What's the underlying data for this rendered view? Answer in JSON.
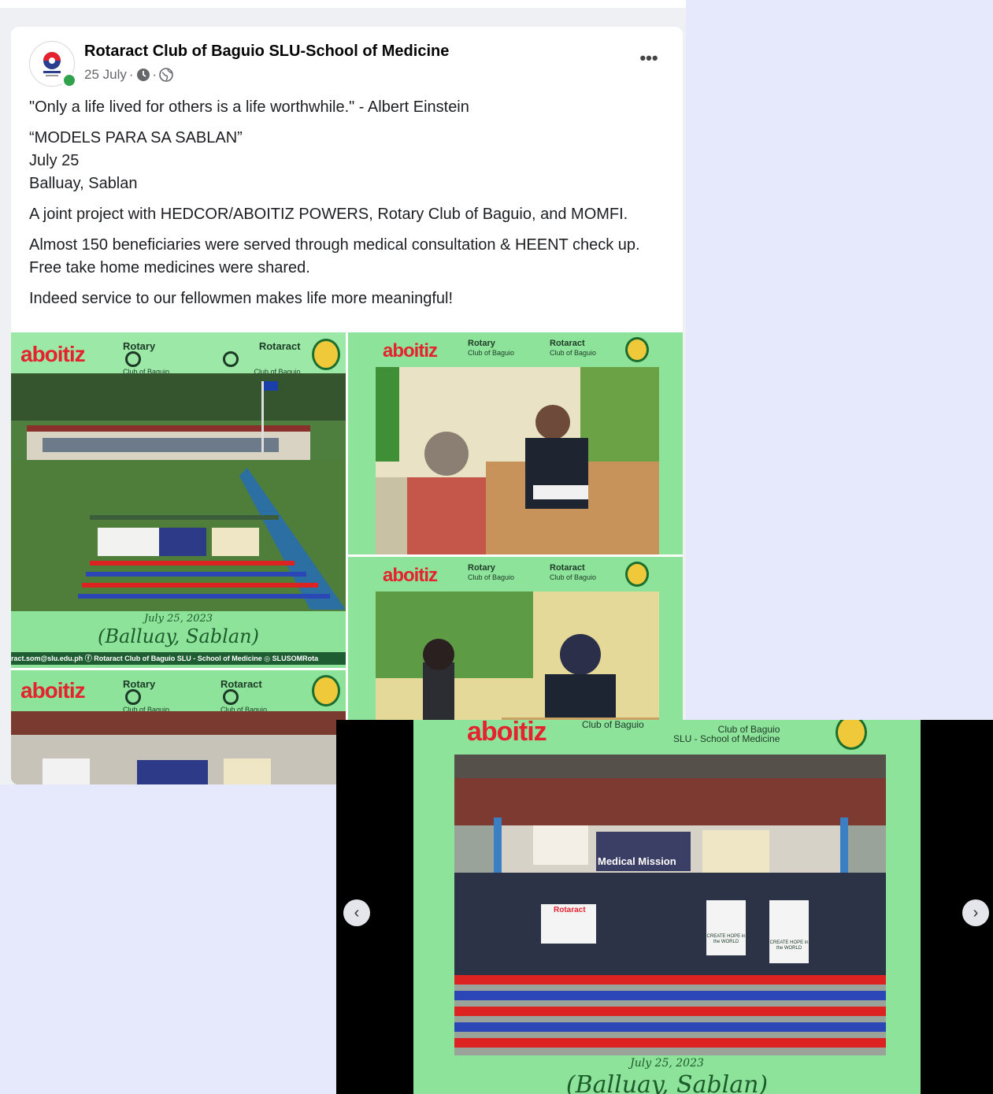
{
  "post": {
    "page_name": "Rotaract Club of Baguio SLU-School of Medicine",
    "date": "25 July",
    "meta_sep": "·",
    "paragraphs": {
      "quote": "\"Only a life lived for others is a life worthwhile.\" - Albert Einstein",
      "title": "“MODELS PARA SA SABLAN”",
      "date_line": "July 25",
      "place_line": "Balluay, Sablan",
      "joint": "A joint project with HEDCOR/ABOITIZ POWERS, Rotary Club of Baguio, and MOMFI.",
      "served": "Almost 150 beneficiaries were served through medical consultation & HEENT check up. Free take home medicines were shared.",
      "closing": "Indeed service to our fellowmen makes life more meaningful!"
    },
    "more_label": "•••"
  },
  "tiles": {
    "brand": "aboitiz",
    "rotary": "Rotary",
    "rotary_sub": "Club of Baguio",
    "rotaract": "Rotaract",
    "rotaract_sub": "Club of Baguio",
    "rotaract_sub2": "SLU - School of Medicine",
    "date_banner": "July 25, 2023",
    "place_banner": "(Balluay, Sablan)",
    "footer": "ract.som@slu.edu.ph  ⓕ Rotaract Club of Baguio SLU - School of Medicine  ◎ SLUSOMRota",
    "medical_mission": "Medical Mission",
    "rotaract_banner": "Rotaract",
    "create_hope": "CREATE HOPE in the WORLD"
  },
  "viewer": {
    "prev": "‹",
    "next": "›"
  },
  "colors": {
    "fb_green": "#31a24c",
    "tile_green": "#8ee39a",
    "aboitiz_red": "#e5232f",
    "dark_green": "#1e5c31"
  }
}
